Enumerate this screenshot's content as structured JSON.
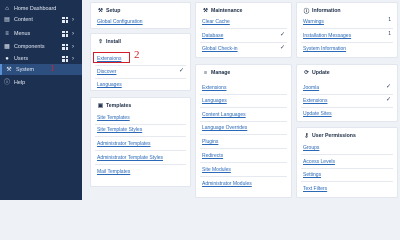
{
  "sidebar": {
    "items": [
      {
        "label": "Home Dashboard",
        "icon": "home-icon"
      },
      {
        "label": "Content",
        "icon": "file-icon"
      },
      {
        "label": "Menus",
        "icon": "list-icon"
      },
      {
        "label": "Components",
        "icon": "cube-icon"
      },
      {
        "label": "Users",
        "icon": "users-icon"
      },
      {
        "label": "System",
        "icon": "wrench-icon"
      },
      {
        "label": "Help",
        "icon": "info-icon"
      }
    ]
  },
  "annotations": {
    "marker1": "1",
    "marker2": "2"
  },
  "colors": {
    "sidebar": "#1c3052",
    "sidebar_active": "#2c4f80",
    "link": "#2a69b8",
    "highlight": "#d0202a"
  },
  "panels": {
    "setup": {
      "title": "Setup",
      "links": [
        "Global Configuration"
      ]
    },
    "install": {
      "title": "Install",
      "links": [
        "Extensions",
        "Discover",
        "Languages"
      ]
    },
    "templates": {
      "title": "Templates",
      "links": [
        "Site Templates",
        "Site Template Styles",
        "Administrator Templates",
        "Administrator Template Styles",
        "Mail Templates"
      ]
    },
    "maintenance": {
      "title": "Maintenance",
      "links": [
        "Clear Cache",
        "Database",
        "Global Check-in"
      ]
    },
    "manage": {
      "title": "Manage",
      "links": [
        "Extensions",
        "Languages",
        "Content Languages",
        "Language Overrides",
        "Plugins",
        "Redirects",
        "Site Modules",
        "Administrator Modules"
      ]
    },
    "information": {
      "title": "Information",
      "links": [
        "Warnings",
        "Installation Messages",
        "System Information"
      ],
      "badges": [
        "1",
        "1"
      ]
    },
    "update": {
      "title": "Update",
      "links": [
        "Joomla",
        "Extensions",
        "Update Sites"
      ]
    },
    "user_permissions": {
      "title": "User Permissions",
      "links": [
        "Groups",
        "Access Levels",
        "Settings",
        "Text Filters"
      ]
    }
  }
}
